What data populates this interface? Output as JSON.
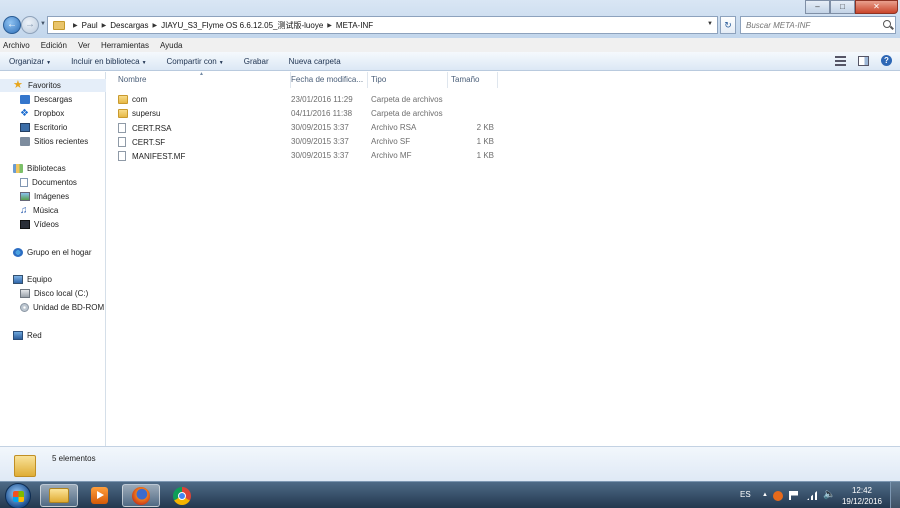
{
  "addressbar": {
    "breadcrumbs": [
      "Paul",
      "Descargas",
      "JIAYU_S3_Flyme OS 6.6.12.05_测试版-luoye",
      "META-INF"
    ]
  },
  "search": {
    "placeholder": "Buscar META-INF"
  },
  "menubar": {
    "items": [
      "Archivo",
      "Edición",
      "Ver",
      "Herramientas",
      "Ayuda"
    ]
  },
  "toolbar": {
    "organizar": "Organizar",
    "incluir": "Incluir en biblioteca",
    "compartir": "Compartir con",
    "grabar": "Grabar",
    "nueva_carpeta": "Nueva carpeta"
  },
  "navpane": {
    "favoritos": "Favoritos",
    "favorites": [
      "Descargas",
      "Dropbox",
      "Escritorio",
      "Sitios recientes"
    ],
    "bibliotecas": "Bibliotecas",
    "libraries": [
      "Documentos",
      "Imágenes",
      "Música",
      "Vídeos"
    ],
    "homegroup": "Grupo en el hogar",
    "equipo": "Equipo",
    "drives": [
      "Disco local (C:)",
      "Unidad de BD-ROM"
    ],
    "red": "Red"
  },
  "filelist": {
    "columns": {
      "name": "Nombre",
      "date": "Fecha de modifica...",
      "type": "Tipo",
      "size": "Tamaño"
    },
    "rows": [
      {
        "name": "com",
        "date": "23/01/2016 11:29",
        "type": "Carpeta de archivos",
        "size": "",
        "kind": "folder"
      },
      {
        "name": "supersu",
        "date": "04/11/2016 11:38",
        "type": "Carpeta de archivos",
        "size": "",
        "kind": "folder"
      },
      {
        "name": "CERT.RSA",
        "date": "30/09/2015 3:37",
        "type": "Archivo RSA",
        "size": "2 KB",
        "kind": "file"
      },
      {
        "name": "CERT.SF",
        "date": "30/09/2015 3:37",
        "type": "Archivo SF",
        "size": "1 KB",
        "kind": "file"
      },
      {
        "name": "MANIFEST.MF",
        "date": "30/09/2015 3:37",
        "type": "Archivo MF",
        "size": "1 KB",
        "kind": "file"
      }
    ]
  },
  "details": {
    "count": "5 elementos"
  },
  "taskbar": {
    "language": "ES",
    "time": "12:42",
    "date": "19/12/2016"
  },
  "colors": {
    "titlebar": "#c2d6ec",
    "selection": "#e5eef9",
    "taskbar": "#23384f"
  }
}
